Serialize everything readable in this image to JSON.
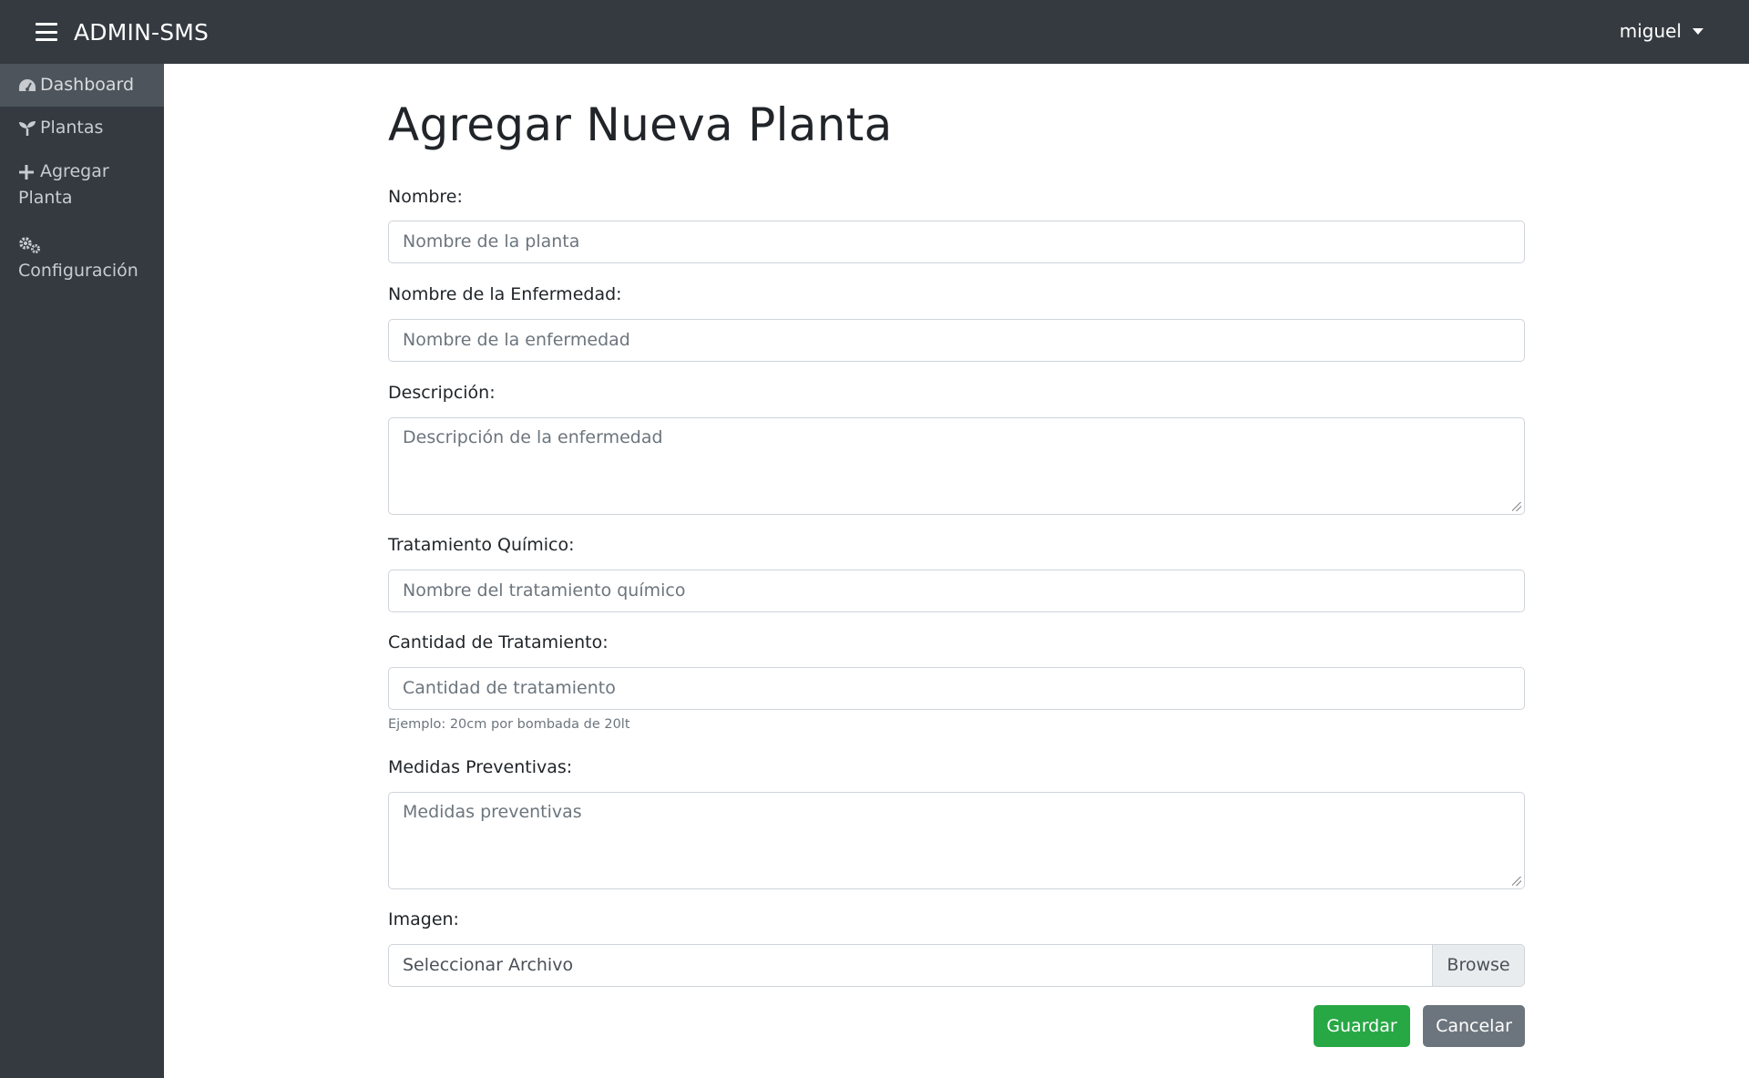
{
  "header": {
    "brand": "ADMIN-SMS",
    "user": "miguel"
  },
  "sidebar": {
    "items": [
      {
        "label": "Dashboard",
        "icon": "dashboard-icon",
        "active": true
      },
      {
        "label": "Plantas",
        "icon": "seedling-icon"
      },
      {
        "label_line1": "Agregar",
        "label_line2": "Planta",
        "icon": "plus-icon"
      },
      {
        "label": "Configuración",
        "icon": "gears-icon"
      }
    ]
  },
  "form": {
    "title": "Agregar Nueva Planta",
    "nombre": {
      "label": "Nombre:",
      "placeholder": "Nombre de la planta"
    },
    "enfermedad": {
      "label": "Nombre de la Enfermedad:",
      "placeholder": "Nombre de la enfermedad"
    },
    "descripcion": {
      "label": "Descripción:",
      "placeholder": "Descripción de la enfermedad"
    },
    "tratamiento": {
      "label": "Tratamiento Químico:",
      "placeholder": "Nombre del tratamiento químico"
    },
    "cantidad": {
      "label": "Cantidad de Tratamiento:",
      "placeholder": "Cantidad de tratamiento",
      "hint": "Ejemplo: 20cm por bombada de 20lt"
    },
    "medidas": {
      "label": "Medidas Preventivas:",
      "placeholder": "Medidas preventivas"
    },
    "imagen": {
      "label": "Imagen:",
      "file_text": "Seleccionar Archivo",
      "browse": "Browse"
    },
    "buttons": {
      "save": "Guardar",
      "cancel": "Cancelar"
    }
  },
  "colors": {
    "topbar": "#343a40",
    "save": "#28a745",
    "cancel": "#6c757d"
  }
}
